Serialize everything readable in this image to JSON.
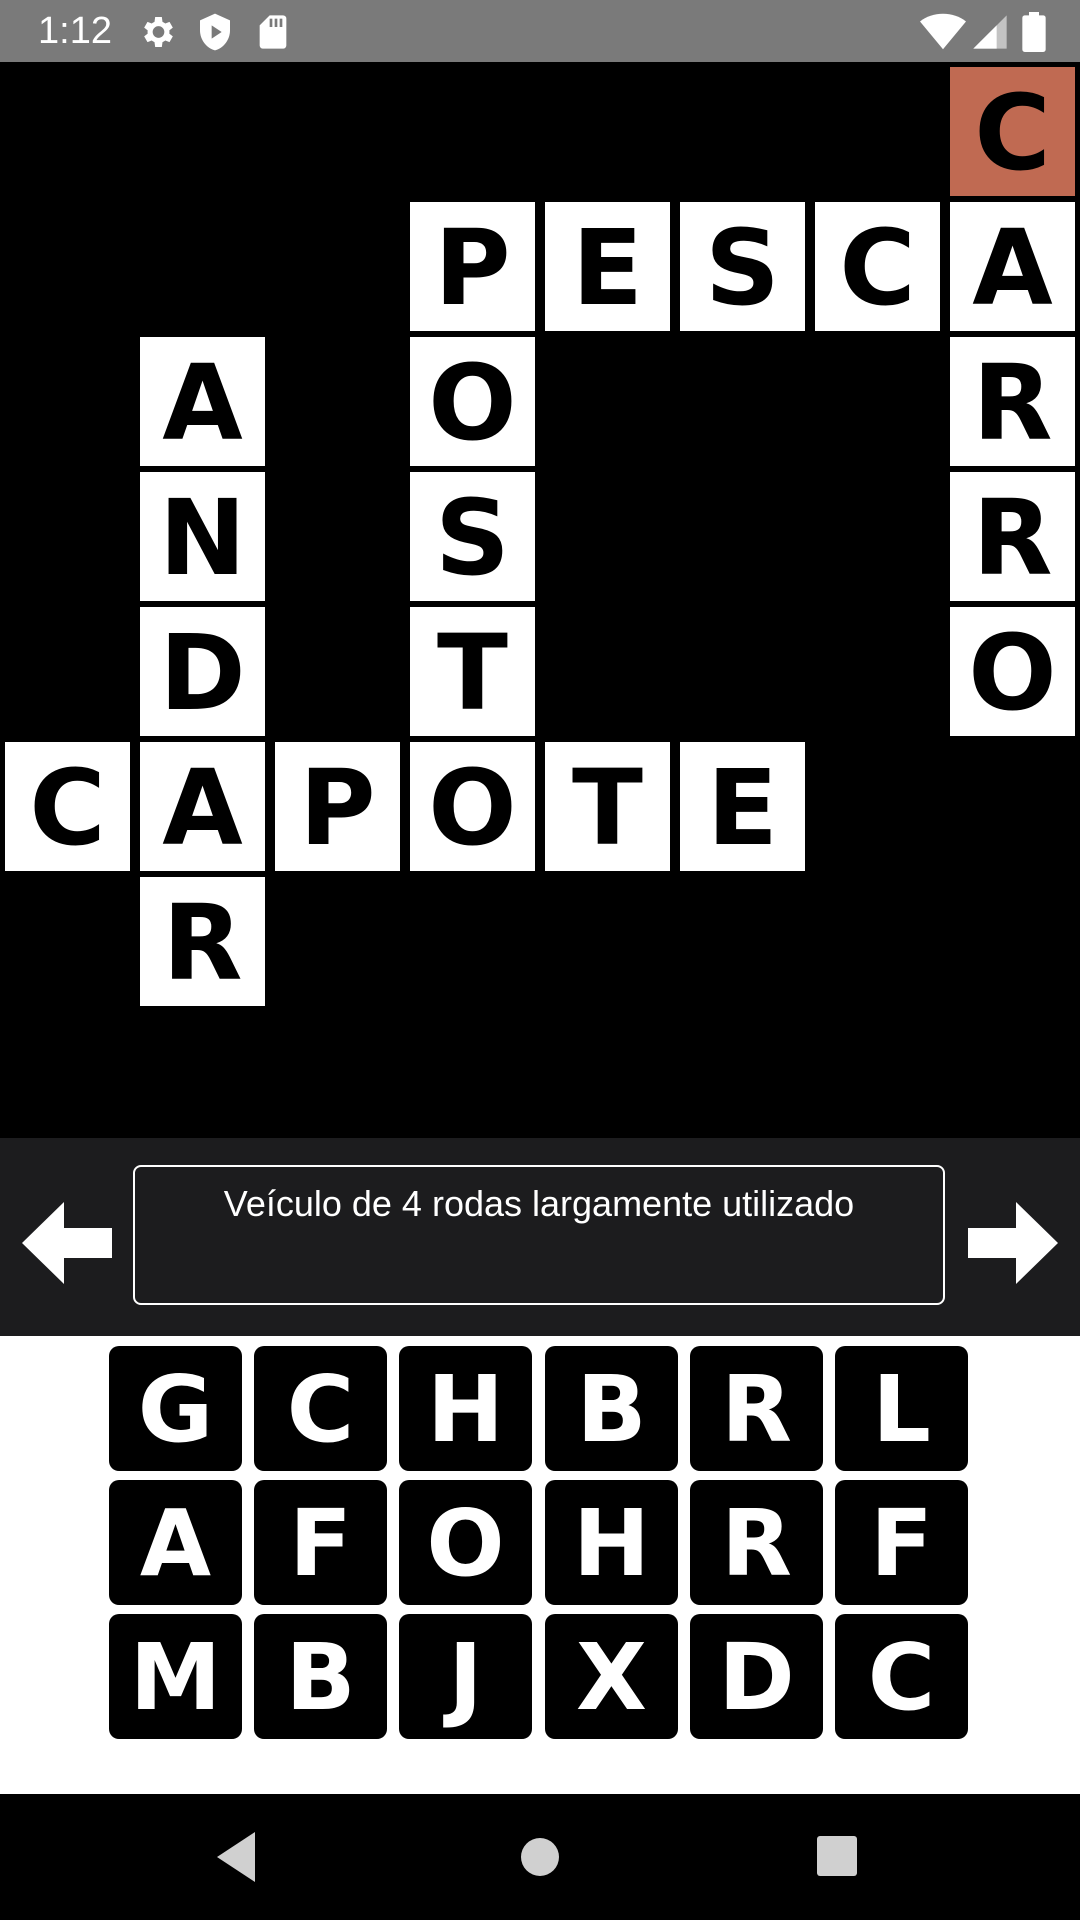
{
  "status_bar": {
    "time": "1:12",
    "icons": [
      "gear-icon",
      "shield-play-icon",
      "sd-card-icon",
      "wifi-icon",
      "signal-icon",
      "battery-icon"
    ]
  },
  "board": {
    "cells": [
      {
        "letter": "C",
        "active": true
      },
      {
        "letter": "P"
      },
      {
        "letter": "E"
      },
      {
        "letter": "S"
      },
      {
        "letter": "C"
      },
      {
        "letter": "A"
      },
      {
        "letter": "A"
      },
      {
        "letter": "O"
      },
      {
        "letter": "R"
      },
      {
        "letter": "N"
      },
      {
        "letter": "S"
      },
      {
        "letter": "R"
      },
      {
        "letter": "D"
      },
      {
        "letter": "T"
      },
      {
        "letter": "O"
      },
      {
        "letter": "C"
      },
      {
        "letter": "A"
      },
      {
        "letter": "P"
      },
      {
        "letter": "O"
      },
      {
        "letter": "T"
      },
      {
        "letter": "E"
      },
      {
        "letter": "R"
      }
    ],
    "active_color": "#c06a52"
  },
  "clue": {
    "text": "Veículo de 4 rodas largamente utilizado"
  },
  "keyboard": {
    "rows": [
      [
        "G",
        "C",
        "H",
        "B",
        "R",
        "L"
      ],
      [
        "A",
        "F",
        "O",
        "H",
        "R",
        "F"
      ],
      [
        "M",
        "B",
        "J",
        "X",
        "D",
        "C"
      ]
    ]
  },
  "nav": {
    "icons": [
      "back-icon",
      "home-icon",
      "recents-icon"
    ]
  }
}
